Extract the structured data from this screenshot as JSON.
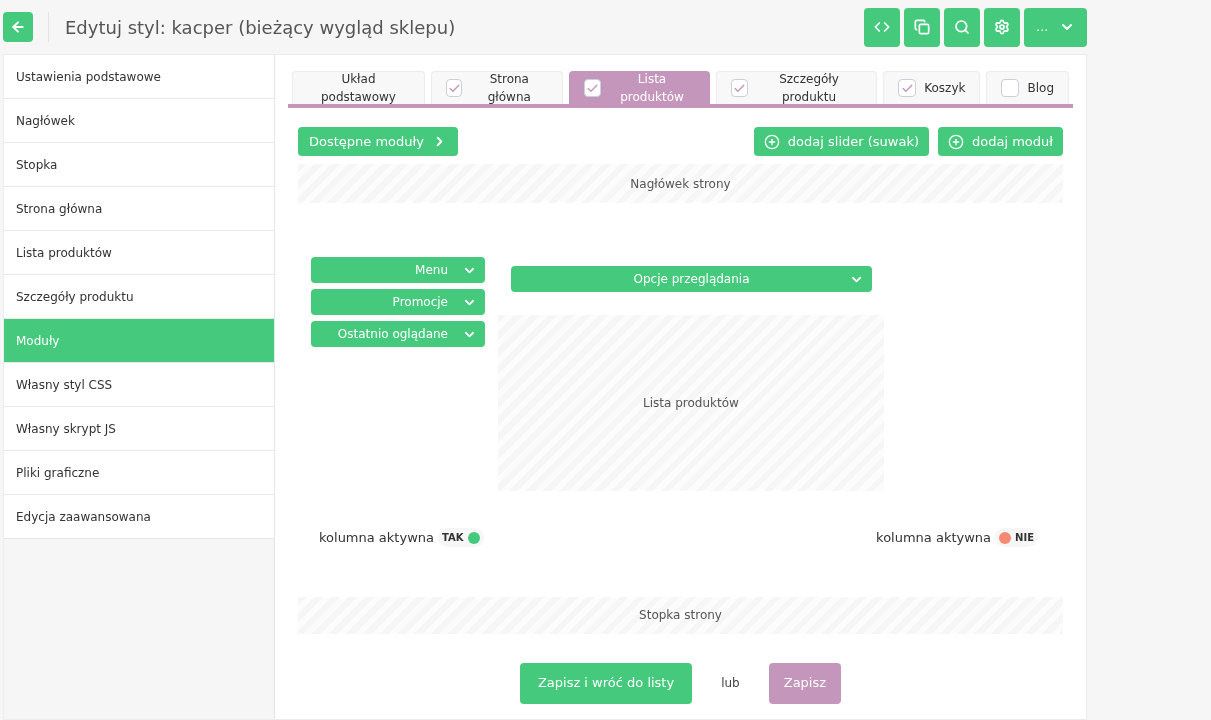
{
  "header": {
    "title": "Edytuj styl: kacper (bieżący wygląd sklepu)",
    "menu_label": "..."
  },
  "sidebar": {
    "items": [
      {
        "label": "Ustawienia podstawowe",
        "selected": false
      },
      {
        "label": "Nagłówek",
        "selected": false
      },
      {
        "label": "Stopka",
        "selected": false
      },
      {
        "label": "Strona główna",
        "selected": false
      },
      {
        "label": "Lista produktów",
        "selected": false
      },
      {
        "label": "Szczegóły produktu",
        "selected": false
      },
      {
        "label": "Moduły",
        "selected": true
      },
      {
        "label": "Własny styl CSS",
        "selected": false
      },
      {
        "label": "Własny skrypt JS",
        "selected": false
      },
      {
        "label": "Pliki graficzne",
        "selected": false
      },
      {
        "label": "Edycja zaawansowana",
        "selected": false
      }
    ]
  },
  "tabs": [
    {
      "label": "Układ podstawowy",
      "kind": "plain",
      "selected": false
    },
    {
      "label": "Strona główna",
      "kind": "checkbox",
      "checked": true,
      "selected": false
    },
    {
      "label": "Lista produktów",
      "kind": "checkbox",
      "checked": true,
      "selected": true
    },
    {
      "label": "Szczegóły produktu",
      "kind": "checkbox",
      "checked": true,
      "selected": false
    },
    {
      "label": "Koszyk",
      "kind": "checkbox",
      "checked": true,
      "selected": false
    },
    {
      "label": "Blog",
      "kind": "checkbox",
      "checked": false,
      "selected": false
    }
  ],
  "toolbar": {
    "available_modules": "Dostępne moduły",
    "add_slider": "dodaj slider (suwak)",
    "add_module": "dodaj moduł"
  },
  "layout": {
    "header_area": "Nagłówek strony",
    "left_modules": [
      "Menu",
      "Promocje",
      "Ostatnio oglądane"
    ],
    "center_module": "Opcje przeglądania",
    "product_area": "Lista produktów",
    "columns": [
      {
        "label": "kolumna aktywna",
        "state": "TAK",
        "active": true
      },
      {
        "label": "kolumna aktywna",
        "state": "NIE",
        "active": false
      }
    ],
    "footer_area": "Stopka strony"
  },
  "actions": {
    "save_back": "Zapisz i wróć do listy",
    "or": "lub",
    "save": "Zapisz"
  }
}
